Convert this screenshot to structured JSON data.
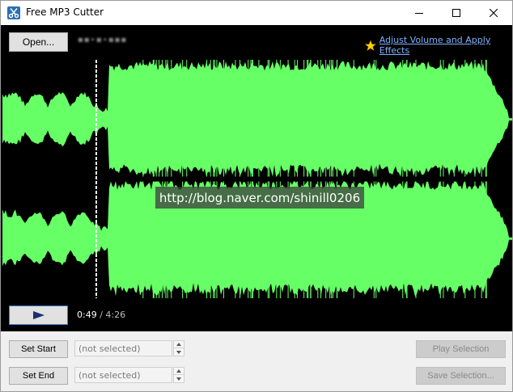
{
  "window": {
    "title": "Free MP3 Cutter"
  },
  "toolbar": {
    "open_label": "Open...",
    "filename": "▪▪∙▪∙▪▪▪",
    "effects_label": "Adjust Volume and Apply Effects"
  },
  "waveform": {
    "color": "#66ff66",
    "background": "#000000",
    "cursor_color": "#ffffff",
    "watermark": "http://blog.naver.com/shinill0206"
  },
  "playback": {
    "current_time": "0:49",
    "separator": " / ",
    "total_time": "4:26",
    "progress_fraction": 0.184
  },
  "selection": {
    "set_start_label": "Set Start",
    "set_end_label": "Set End",
    "start_placeholder": "(not selected)",
    "end_placeholder": "(not selected)",
    "play_selection_label": "Play Selection",
    "save_selection_label": "Save Selection..."
  },
  "icons": {
    "app": "scissors-icon",
    "minimize": "minimize-icon",
    "maximize": "maximize-icon",
    "close": "close-icon",
    "effects": "star-icon",
    "play": "play-icon",
    "spinner_up": "arrow-up-icon",
    "spinner_down": "arrow-down-icon"
  }
}
